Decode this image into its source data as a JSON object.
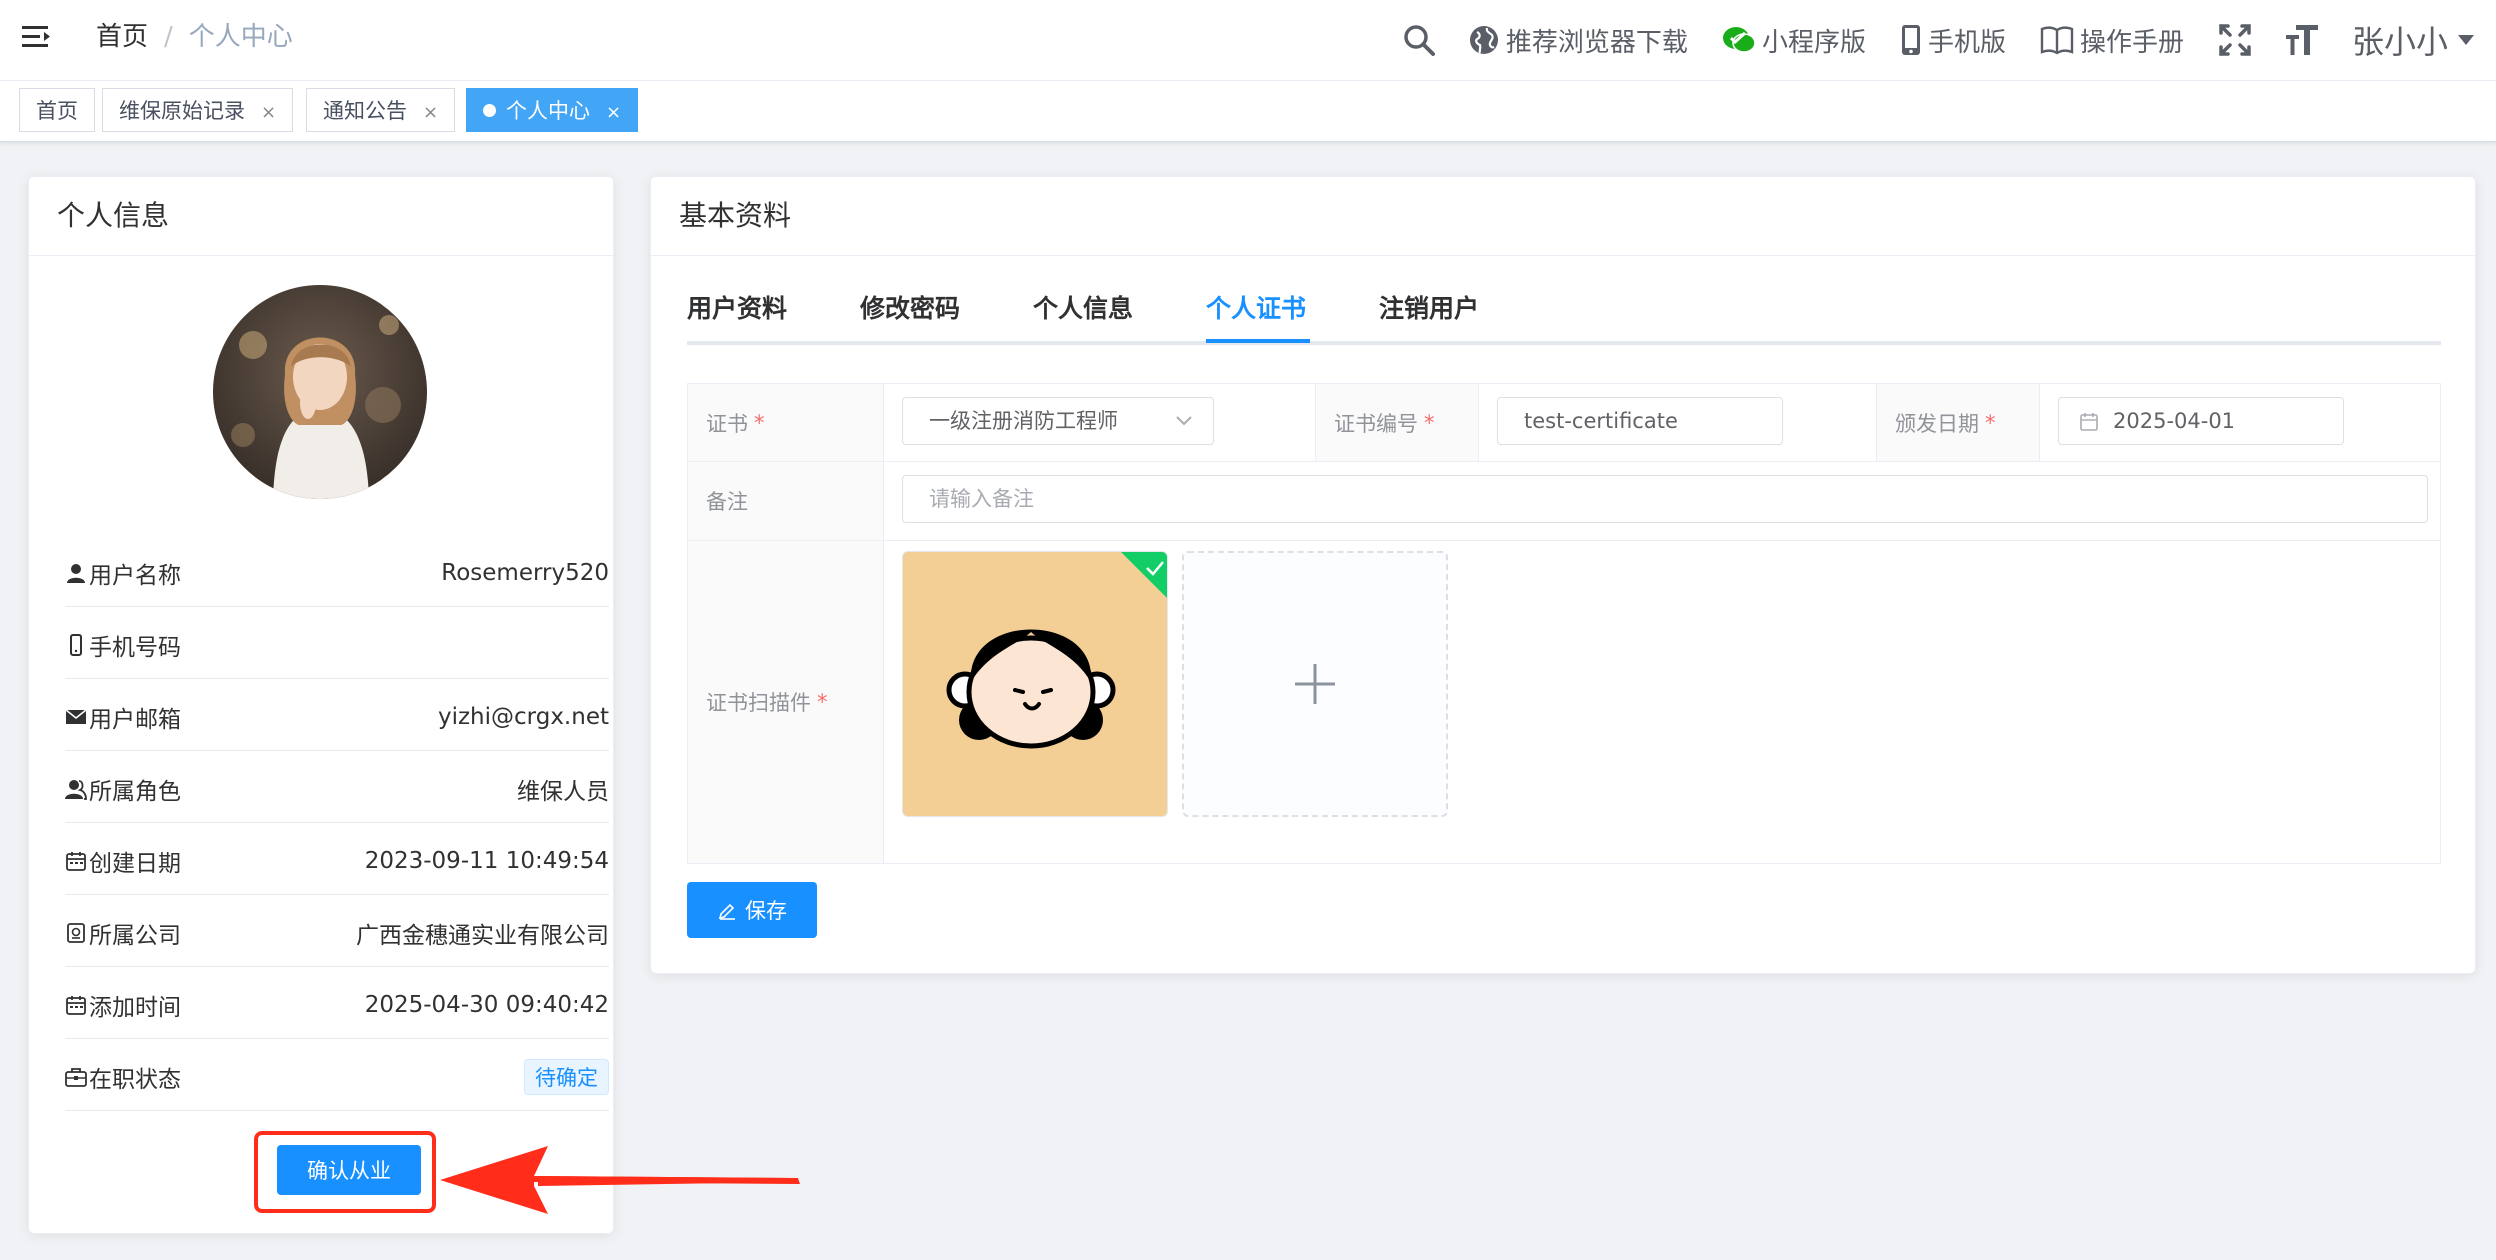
{
  "navbar": {
    "breadcrumb": {
      "home": "首页",
      "separator": "/",
      "current": "个人中心"
    },
    "items": {
      "browser_download": "推荐浏览器下载",
      "mini_program": "小程序版",
      "mobile": "手机版",
      "manual": "操作手册"
    },
    "user_name": "张小小",
    "icons": [
      "hamburger-icon",
      "search-icon",
      "globe-icon",
      "wechat-icon",
      "mobile-icon",
      "book-icon",
      "fullscreen-icon",
      "font-size-icon"
    ]
  },
  "tags": [
    {
      "label": "首页",
      "active": false,
      "closable": false
    },
    {
      "label": "维保原始记录",
      "active": false,
      "closable": true
    },
    {
      "label": "通知公告",
      "active": false,
      "closable": true
    },
    {
      "label": "个人中心",
      "active": true,
      "closable": true
    }
  ],
  "tag_close": "×",
  "profile_card": {
    "title": "个人信息",
    "rows": {
      "username": {
        "label": "用户名称",
        "value": "Rosemerry520",
        "icon": "user-icon"
      },
      "phone": {
        "label": "手机号码",
        "value": "",
        "icon": "phone-icon"
      },
      "email": {
        "label": "用户邮箱",
        "value": "yizhi@crgx.net",
        "icon": "mail-icon"
      },
      "role": {
        "label": "所属角色",
        "value": "维保人员",
        "icon": "role-icon"
      },
      "created": {
        "label": "创建日期",
        "value": "2023-09-11 10:49:54",
        "icon": "calendar-icon"
      },
      "company": {
        "label": "所属公司",
        "value": "广西金穗通实业有限公司",
        "icon": "company-icon"
      },
      "added": {
        "label": "添加时间",
        "value": "2025-04-30 09:40:42",
        "icon": "calendar-icon"
      },
      "status": {
        "label": "在职状态",
        "value": "待确定",
        "icon": "briefcase-icon"
      }
    },
    "confirm_button": "确认从业"
  },
  "basic_card": {
    "title": "基本资料",
    "tabs": [
      "用户资料",
      "修改密码",
      "个人信息",
      "个人证书",
      "注销用户"
    ],
    "active_tab": "个人证书",
    "form": {
      "certificate_label": "证书",
      "certificate_value": "一级注册消防工程师",
      "cert_no_label": "证书编号",
      "cert_no_value": "test-certificate",
      "issue_date_label": "颁发日期",
      "issue_date_value": "2025-04-01",
      "remark_label": "备注",
      "remark_placeholder": "请输入备注",
      "scan_label": "证书扫描件",
      "required_mark": "*"
    },
    "save_button": "保存"
  },
  "colors": {
    "primary": "#1890ff",
    "active_tag": "#42a5f5",
    "annotation_red": "#ff2d1a",
    "success_corner": "#13ce66"
  }
}
